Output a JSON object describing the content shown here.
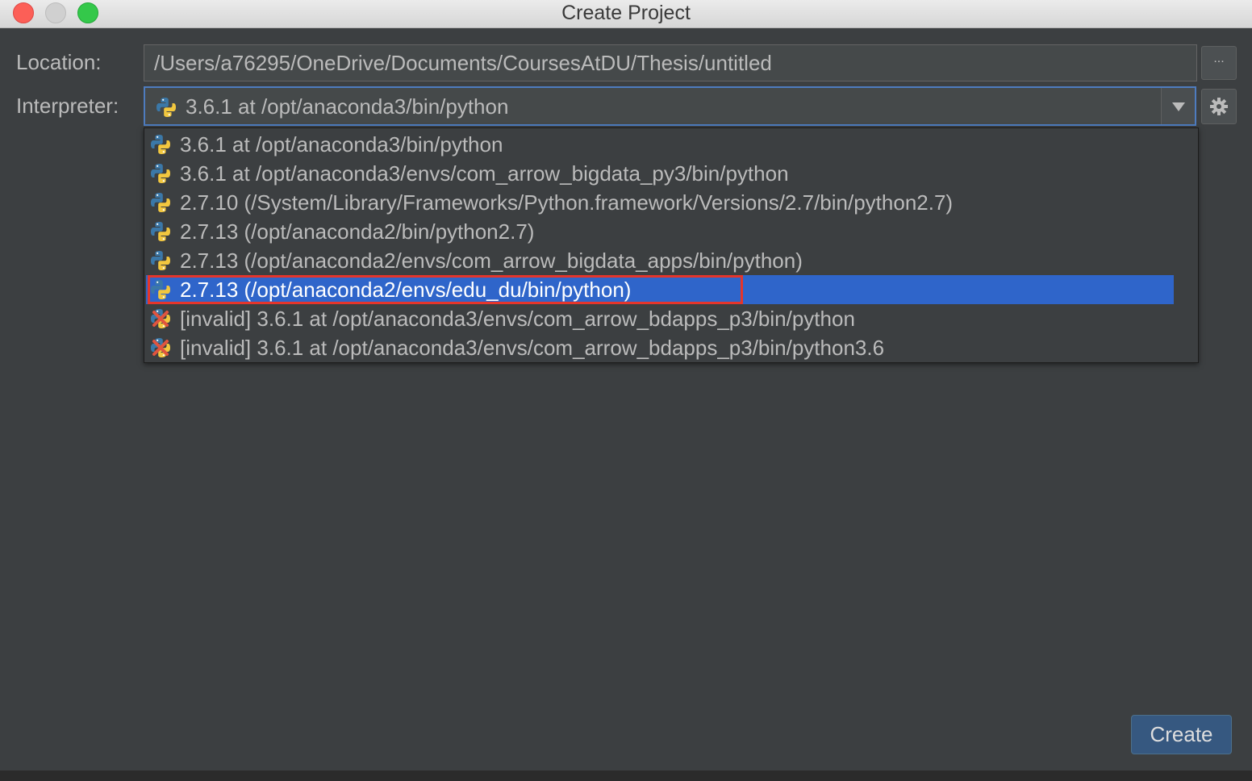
{
  "window": {
    "title": "Create Project"
  },
  "location": {
    "label": "Location:",
    "value": "/Users/a76295/OneDrive/Documents/CoursesAtDU/Thesis/untitled",
    "browse_label": "..."
  },
  "interpreter": {
    "label": "Interpreter:",
    "selected": "3.6.1 at /opt/anaconda3/bin/python",
    "options": [
      {
        "label": "3.6.1 at /opt/anaconda3/bin/python",
        "icon": "python-icon"
      },
      {
        "label": "3.6.1 at /opt/anaconda3/envs/com_arrow_bigdata_py3/bin/python",
        "icon": "python-icon"
      },
      {
        "label": "2.7.10 (/System/Library/Frameworks/Python.framework/Versions/2.7/bin/python2.7)",
        "icon": "python-icon"
      },
      {
        "label": "2.7.13 (/opt/anaconda2/bin/python2.7)",
        "icon": "python-icon"
      },
      {
        "label": "2.7.13 (/opt/anaconda2/envs/com_arrow_bigdata_apps/bin/python)",
        "icon": "python-icon"
      },
      {
        "label": "2.7.13 (/opt/anaconda2/envs/edu_du/bin/python)",
        "icon": "python-icon",
        "highlighted": true
      },
      {
        "label": "[invalid] 3.6.1 at /opt/anaconda3/envs/com_arrow_bdapps_p3/bin/python",
        "icon": "invalid-python-icon"
      },
      {
        "label": "[invalid] 3.6.1 at /opt/anaconda3/envs/com_arrow_bdapps_p3/bin/python3.6",
        "icon": "invalid-python-icon"
      }
    ]
  },
  "actions": {
    "create_label": "Create"
  },
  "colors": {
    "background": "#3c3f41",
    "selection": "#2f65ca",
    "annotation_box": "#e5352b",
    "primary_button": "#365880"
  }
}
